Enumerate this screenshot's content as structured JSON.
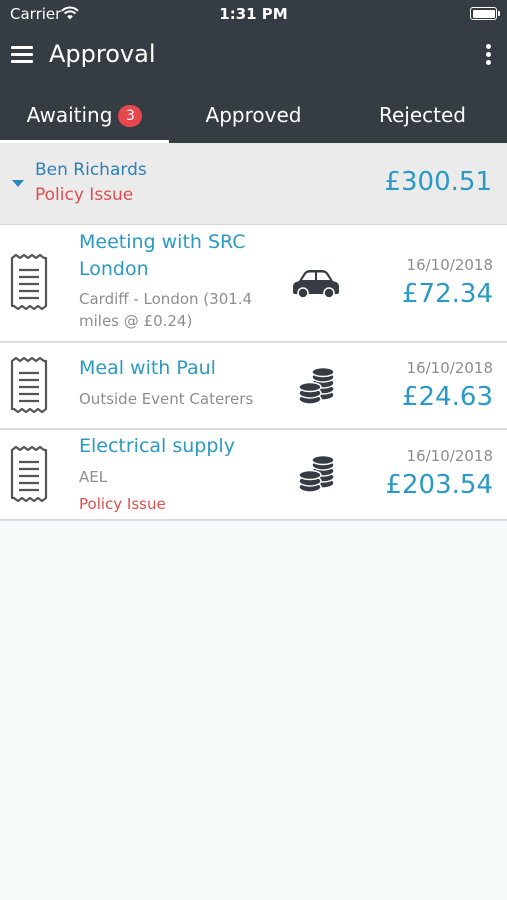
{
  "status_bar": {
    "carrier": "Carrier",
    "time": "1:31 PM"
  },
  "header": {
    "title": "Approval"
  },
  "tabs": [
    {
      "label": "Awaiting",
      "badge": "3",
      "active": true
    },
    {
      "label": "Approved",
      "active": false
    },
    {
      "label": "Rejected",
      "active": false
    }
  ],
  "group": {
    "name": "Ben Richards",
    "issue": "Policy Issue",
    "amount": "£300.51"
  },
  "expenses": [
    {
      "title": "Meeting with SRC London",
      "subtitle": "Cardiff - London (301.4 miles @ £0.24)",
      "date": "16/10/2018",
      "amount": "£72.34",
      "icon": "car-icon"
    },
    {
      "title": "Meal with Paul",
      "subtitle": "Outside Event Caterers",
      "date": "16/10/2018",
      "amount": "£24.63",
      "icon": "coins-icon"
    },
    {
      "title": "Electrical supply",
      "subtitle": "AEL",
      "issue": "Policy Issue",
      "date": "16/10/2018",
      "amount": "£203.54",
      "icon": "coins-icon"
    }
  ],
  "colors": {
    "header_bg": "#353c43",
    "accent": "#2a9ac5",
    "issue": "#e04e4e",
    "badge": "#e6484d"
  }
}
